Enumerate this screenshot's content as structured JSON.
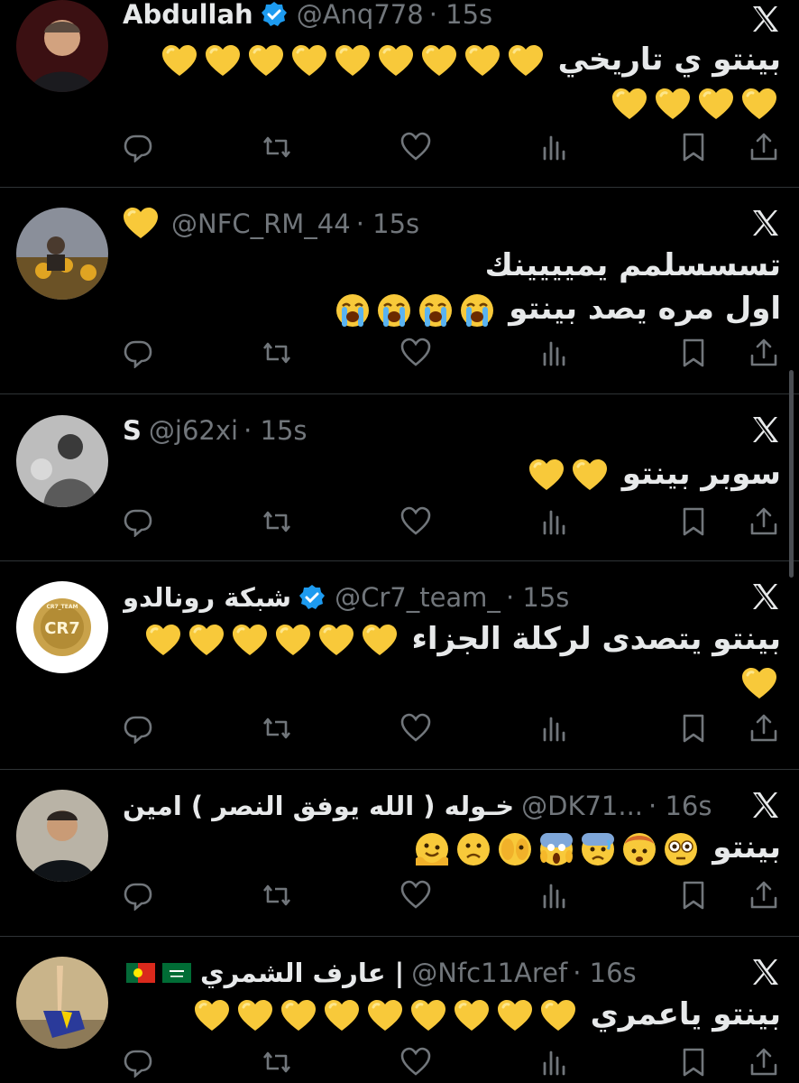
{
  "tweets": [
    {
      "name": "Abdullah",
      "handle": "@Anq778",
      "time": "· 15s",
      "verified": true,
      "text": "بينتو ي تاريخي",
      "hearts": 13,
      "avatar": "man-portrait"
    },
    {
      "name": "",
      "handle": "@NFC_RM_44",
      "time": "· 15s",
      "verified": false,
      "name_emoji": "yellow-heart",
      "text_line1": "تسسسلمم يميييينك",
      "text_line2": "اول مره يصد بينتو",
      "crying": 4,
      "avatar": "sunflower-field"
    },
    {
      "name": "S",
      "handle": "@j62xi",
      "time": "· 15s",
      "verified": false,
      "text": "سوبر بينتو",
      "hearts": 2,
      "avatar": "bw-photo"
    },
    {
      "name": "شبكة رونالدو",
      "handle": "@Cr7_team_",
      "time": "· 15s",
      "verified": true,
      "text": "بينتو يتصدى لركلة الجزاء",
      "hearts": 7,
      "avatar": "cr7-team-logo",
      "logo_text": "CR7",
      "logo_ring": "CR7_TEAM"
    },
    {
      "name": "خـوله ( الله يوفق النصر ) امين",
      "handle": "@DK71...",
      "time": "· 16s",
      "verified": false,
      "text": "بينتو",
      "emojis": [
        "flushed-face",
        "exploding-head",
        "anxious-face",
        "screaming-face",
        "face-with-peeking-eye",
        "slightly-frowning-face",
        "melting-face"
      ],
      "avatar": "player-portrait"
    },
    {
      "name": "عارف الشمري |",
      "handle": "@Nfc11Aref",
      "time": "· 16s",
      "verified": false,
      "flags": [
        "portugal-flag",
        "saudi-flag"
      ],
      "text": "بينتو ياعمري",
      "hearts": 9,
      "avatar": "statue-figure"
    }
  ],
  "icons": {
    "reply": "reply-icon",
    "retweet": "retweet-icon",
    "like": "heart-outline-icon",
    "views": "views-icon",
    "bookmark": "bookmark-icon",
    "share": "share-icon",
    "platform": "x-logo-icon"
  },
  "colors": {
    "background": "#000000",
    "text": "#e7e9ea",
    "muted": "#71767b",
    "verified": "#1d9bf0",
    "heart": "#f8c93a"
  }
}
